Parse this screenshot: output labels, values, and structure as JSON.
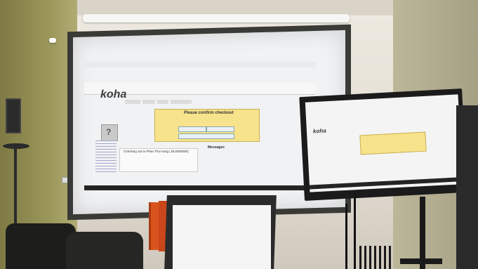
{
  "scene": {
    "projected_ui": {
      "logo": "koha",
      "confirm_title": "Please confirm checkout",
      "section_title": "Checking out to Phan Thu Hong ( BL0000000)",
      "messages_title": "Messages"
    },
    "monitor_ui": {
      "logo": "koha"
    }
  },
  "colors": {
    "banner": "#f7e38b",
    "taskbar": "#242424",
    "binder": "#d9531f"
  }
}
